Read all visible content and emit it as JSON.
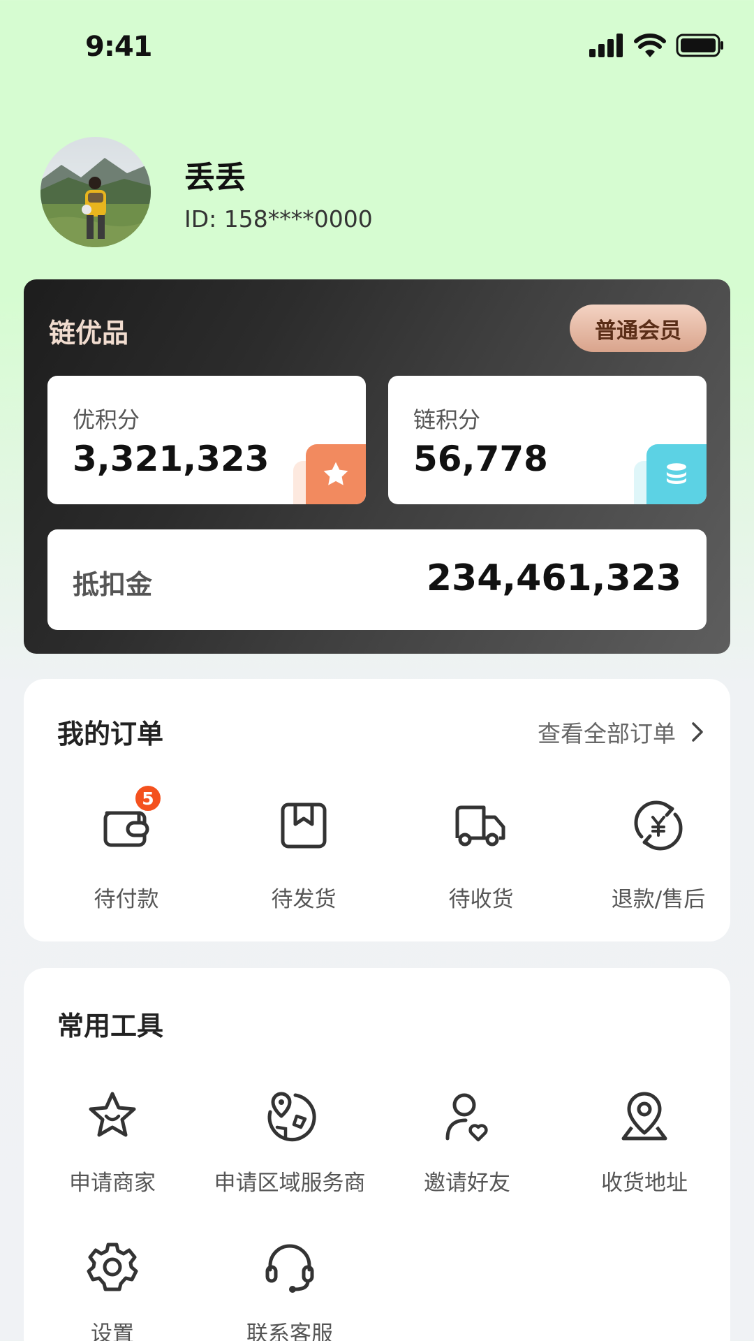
{
  "status_bar": {
    "time": "9:41"
  },
  "profile": {
    "name": "丢丢",
    "id_text": "ID: 158****0000"
  },
  "member_card": {
    "brand": "链优品",
    "level": "普通会员",
    "points": [
      {
        "label": "优积分",
        "value": "3,321,323",
        "icon": "star-icon",
        "color": "#f28a5f"
      },
      {
        "label": "链积分",
        "value": "56,778",
        "icon": "coin-stack-icon",
        "color": "#5cd2e4"
      }
    ],
    "deduction": {
      "label": "抵扣金",
      "value": "234,461,323"
    }
  },
  "orders": {
    "title": "我的订单",
    "view_all": "查看全部订单",
    "items": [
      {
        "label": "待付款",
        "icon": "wallet-icon",
        "badge": "5"
      },
      {
        "label": "待发货",
        "icon": "package-icon"
      },
      {
        "label": "待收货",
        "icon": "truck-icon"
      },
      {
        "label": "退款/售后",
        "icon": "refund-icon"
      }
    ]
  },
  "tools": {
    "title": "常用工具",
    "items": [
      {
        "label": "申请商家",
        "icon": "star-smile-icon"
      },
      {
        "label": "申请区域服务商",
        "icon": "globe-pin-icon"
      },
      {
        "label": "邀请好友",
        "icon": "user-heart-icon"
      },
      {
        "label": "收货地址",
        "icon": "location-pin-icon"
      },
      {
        "label": "设置",
        "icon": "gear-icon"
      },
      {
        "label": "联系客服",
        "icon": "headset-icon"
      }
    ]
  },
  "colors": {
    "accent_badge": "#f4511e",
    "page_top": "#d6fcd1",
    "page_bottom": "#f0f2f5"
  }
}
